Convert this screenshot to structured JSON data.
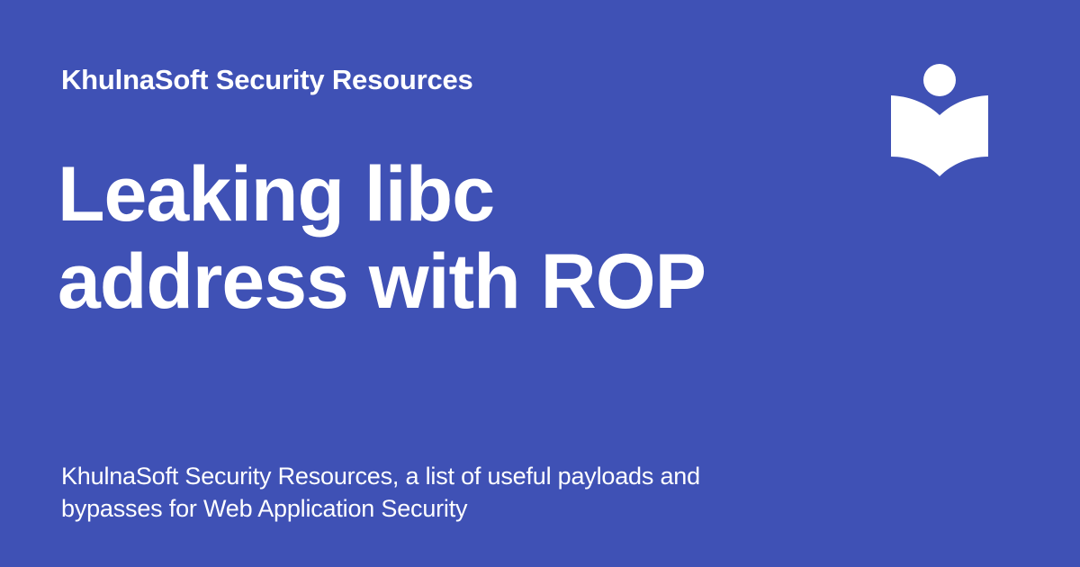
{
  "site": {
    "name": "KhulnaSoft Security Resources"
  },
  "page": {
    "title_lines": [
      "Leaking libc",
      "address with ROP"
    ],
    "description_lines": [
      "KhulnaSoft Security Resources, a list of useful payloads and",
      "bypasses for Web Application Security"
    ]
  },
  "logo": {
    "icon": "reader-book-icon"
  },
  "colors": {
    "background": "#3f51b5",
    "text": "#ffffff"
  }
}
